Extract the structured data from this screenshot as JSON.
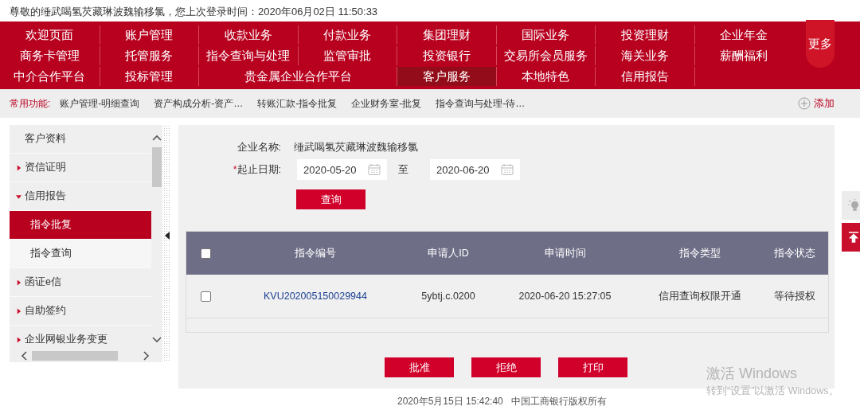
{
  "greeting": "尊敬的缍武喝氢芡藏琳波魏输移氯，您上次登录时间：2020年06月02日 11:50:33",
  "nav": {
    "rows": [
      [
        {
          "label": "欢迎页面",
          "kind": "normal",
          "selected": false
        },
        {
          "label": "账户管理",
          "kind": "normal",
          "selected": false
        },
        {
          "label": "收款业务",
          "kind": "normal",
          "selected": false
        },
        {
          "label": "付款业务",
          "kind": "normal",
          "selected": false
        },
        {
          "label": "集团理财",
          "kind": "normal",
          "selected": false
        },
        {
          "label": "国际业务",
          "kind": "normal",
          "selected": false
        },
        {
          "label": "投资理财",
          "kind": "normal",
          "selected": false
        },
        {
          "label": "企业年金",
          "kind": "normal",
          "selected": false
        }
      ],
      [
        {
          "label": "商务卡管理",
          "kind": "normal",
          "selected": false
        },
        {
          "label": "托管服务",
          "kind": "normal",
          "selected": false
        },
        {
          "label": "指令查询与处理",
          "kind": "normal",
          "selected": false
        },
        {
          "label": "监管审批",
          "kind": "normal",
          "selected": false
        },
        {
          "label": "投资银行",
          "kind": "normal",
          "selected": false
        },
        {
          "label": "交易所会员服务",
          "kind": "normal",
          "selected": false
        },
        {
          "label": "海关业务",
          "kind": "normal",
          "selected": false
        },
        {
          "label": "薪酬福利",
          "kind": "normal",
          "selected": false
        }
      ],
      [
        {
          "label": "中介合作平台",
          "kind": "normal",
          "selected": false
        },
        {
          "label": "投标管理",
          "kind": "normal",
          "selected": false
        },
        {
          "label": "贵金属企业合作平台",
          "kind": "wide",
          "selected": false
        },
        {
          "kind": "covered"
        },
        {
          "label": "客户服务",
          "kind": "normal",
          "selected": true
        },
        {
          "label": "本地特色",
          "kind": "normal",
          "selected": false
        },
        {
          "label": "信用报告",
          "kind": "normal",
          "selected": false
        }
      ]
    ],
    "more": "更多"
  },
  "quick_bar": {
    "label": "常用功能:",
    "links": [
      "账户管理-明细查询",
      "资产构成分析-资产…",
      "转账汇款-指令批复",
      "企业财务室-批复",
      "指令查询与处理-待…"
    ],
    "add": "添加"
  },
  "sidebar": {
    "items": [
      {
        "label": "客户资料",
        "kind": "plain"
      },
      {
        "label": "资信证明",
        "kind": "group",
        "expanded": false
      },
      {
        "label": "信用报告",
        "kind": "group",
        "expanded": true,
        "children": [
          {
            "label": "指令批复",
            "selected": true
          },
          {
            "label": "指令查询",
            "selected": false
          }
        ]
      },
      {
        "label": "函证e信",
        "kind": "group",
        "expanded": false
      },
      {
        "label": "自助签约",
        "kind": "group",
        "expanded": false
      },
      {
        "label": "企业网银业务变更",
        "kind": "group",
        "expanded": false
      }
    ]
  },
  "form": {
    "company_label": "企业名称:",
    "company_value": "缍武喝氢芡藏琳波魏输移氯",
    "date_label": "起止日期:",
    "required_mark": "*",
    "start_date": "2020-05-20",
    "to": "至",
    "end_date": "2020-06-20",
    "query_button": "查询"
  },
  "table": {
    "header_checked": false,
    "columns": [
      "指令编号",
      "申请人ID",
      "申请时间",
      "指令类型",
      "指令状态"
    ],
    "rows": [
      {
        "checked": false,
        "id": "KVU202005150029944",
        "applicant": "5ybtj.c.0200",
        "time": "2020-06-20 15:27:05",
        "type": "信用查询权限开通",
        "status": "等待授权"
      }
    ]
  },
  "actions": [
    "批准",
    "拒绝",
    "打印"
  ],
  "footer": "2020年5月15日 15:42:40   中国工商银行版权所有",
  "activation": {
    "title": "激活 Windows",
    "subtitle": "转到“设置”以激活 Windows。"
  }
}
